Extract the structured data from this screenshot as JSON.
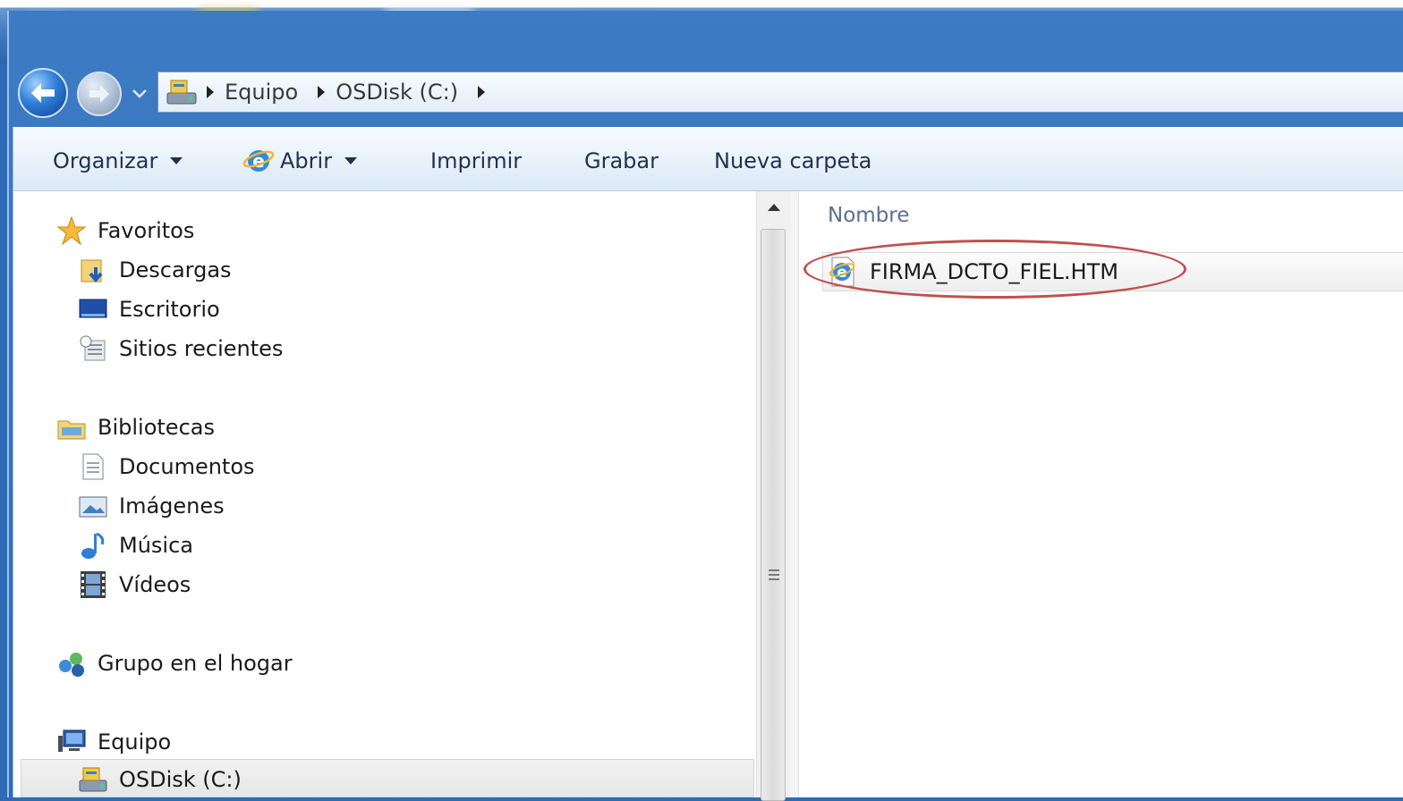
{
  "address_bar": {
    "breadcrumbs": [
      "Equipo",
      "OSDisk (C:)"
    ]
  },
  "toolbar": {
    "organize_label": "Organizar",
    "open_label": "Abrir",
    "print_label": "Imprimir",
    "burn_label": "Grabar",
    "new_folder_label": "Nueva carpeta"
  },
  "navigation": {
    "favorites": {
      "label": "Favoritos",
      "items": [
        "Descargas",
        "Escritorio",
        "Sitios recientes"
      ]
    },
    "libraries": {
      "label": "Bibliotecas",
      "items": [
        "Documentos",
        "Imágenes",
        "Música",
        "Vídeos"
      ]
    },
    "homegroup": {
      "label": "Grupo en el hogar"
    },
    "computer": {
      "label": "Equipo",
      "items": [
        "OSDisk (C:)"
      ]
    }
  },
  "content": {
    "column_header": "Nombre",
    "files": [
      "FIRMA_DCTO_FIEL.HTM"
    ]
  },
  "colors": {
    "highlight": "#c0504d",
    "titlebar": "#2d6bb4"
  }
}
